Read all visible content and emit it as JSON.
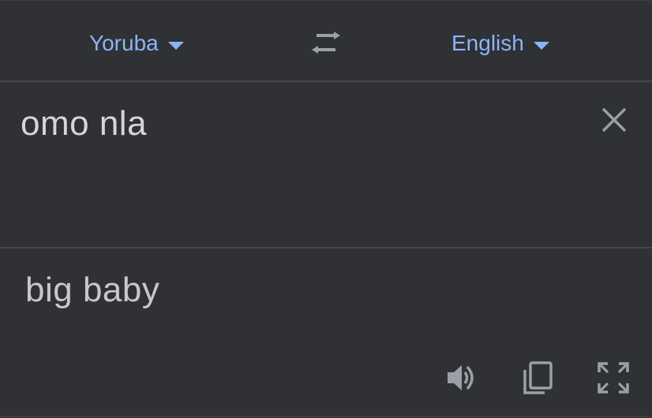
{
  "languages": {
    "source": "Yoruba",
    "target": "English"
  },
  "source": {
    "text": "omo nla"
  },
  "result": {
    "text": "big baby"
  },
  "icons": {
    "swap": "swap-languages-icon",
    "clear": "close-icon",
    "listen": "speaker-icon",
    "copy": "copy-icon",
    "fullscreen": "fullscreen-icon"
  },
  "colors": {
    "background": "#303134",
    "accent": "#8ab4f8",
    "text": "#d5d6d8",
    "icon": "#9aa0a6",
    "divider": "#45474b"
  }
}
